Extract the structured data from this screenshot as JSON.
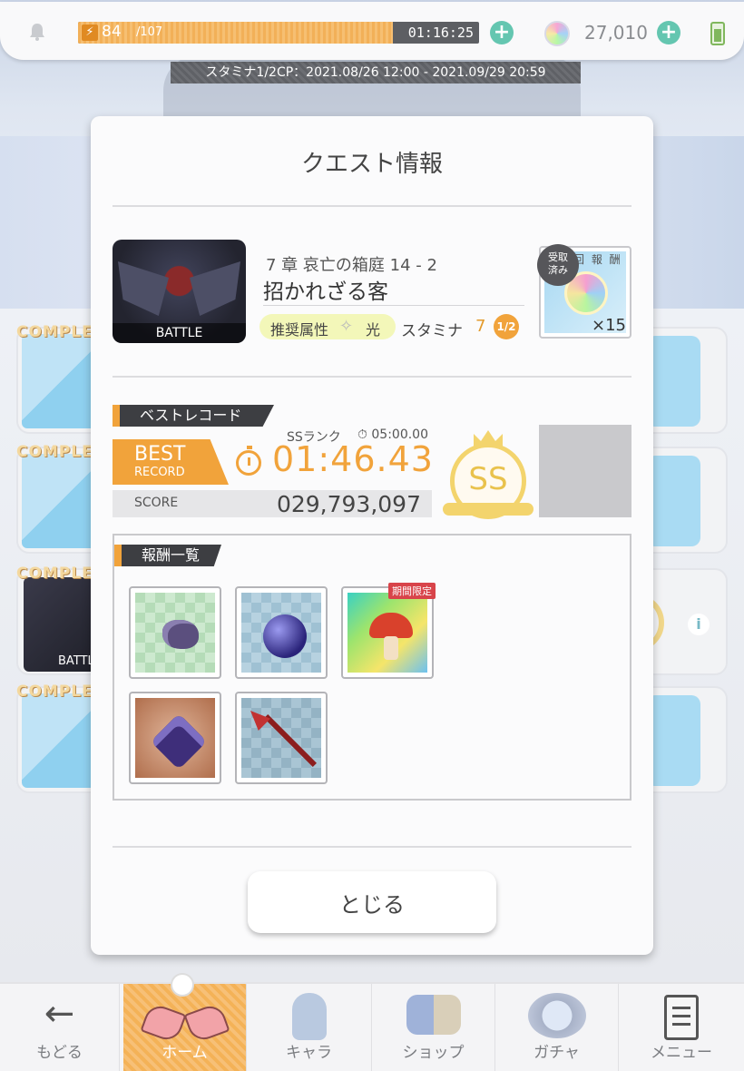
{
  "topbar": {
    "stamina_current": "84",
    "stamina_max": "/107",
    "stamina_fill_fraction": 0.785,
    "stamina_timer": "01:16:25",
    "gem_count": "27,010",
    "campaign_text": "スタミナ1/2CP：2021.08/26 12:00 - 2021.09/29 20:59"
  },
  "background": {
    "complete_label": "COMPLETE",
    "battle_label": "BATTLE",
    "info_glyph": "i"
  },
  "modal": {
    "title": "クエスト情報",
    "quest": {
      "thumb_label": "BATTLE",
      "chapter": "7 章 哀亡の箱庭 14 - 2",
      "name": "招かれざる客",
      "attr_label": "推奨属性",
      "attr_value": "光",
      "stamina_label": "スタミナ",
      "stamina_cost": "7",
      "stamina_half": "1/2"
    },
    "first_reward": {
      "caption": "回 報 酬",
      "stamp": "受取\n済み",
      "qty": "×15"
    },
    "best_record": {
      "tag": "ベストレコード",
      "badge_line1": "BEST",
      "badge_line2": "RECORD",
      "time": "01:46.43",
      "ss_rank_label": "SSランク",
      "ss_rank_time": "05:00.00",
      "score_label": "SCORE",
      "score_value": "029,793,097",
      "rank": "SS"
    },
    "rewards": {
      "tag": "報酬一覧",
      "limited_label": "期間限定"
    },
    "close_label": "とじる"
  },
  "nav": {
    "back": "もどる",
    "home": "ホーム",
    "chara": "キャラ",
    "shop": "ショップ",
    "gacha": "ガチャ",
    "menu": "メニュー"
  },
  "colors": {
    "accent_orange": "#f1a33b",
    "teal_plus": "#64c6b0"
  }
}
